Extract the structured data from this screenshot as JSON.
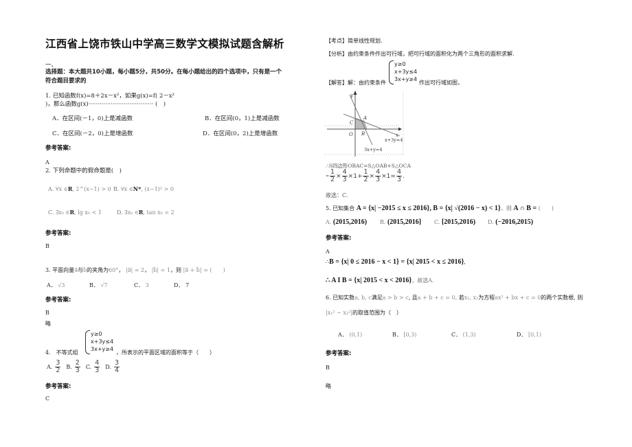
{
  "document": {
    "title": "江西省上饶市铁山中学高三数学文模拟试题含解析",
    "section_number": "一、",
    "section_desc_line1": "选择题：本大题共10小题，每小题5分，共50分。在每小题给出的四个选项中，只有是一个",
    "section_desc_line2": "符合题目要求的",
    "answer_label": "参考答案:"
  },
  "questions": [
    {
      "stem_line1": "1. 已知函数f(x)=8＋2x－x²，如果g(x)=f( 2－x²",
      "stem_line2": ")，那么函数g(x)··································· (　)",
      "options": [
        "A．在区间(－1，0)上是减函数",
        "B．在区间(0，1)上是减函数",
        "C．在区间(－2，0)上是增函数",
        "D．在区间(0，2)上是增函数"
      ],
      "answer": "A"
    },
    {
      "stem": "2. 下列命题中的假命题是(　)",
      "options": [
        {
          "label": "A.",
          "text": "∀x ∈",
          "set": "R",
          "tail": ", 2^(x−1) > 0"
        },
        {
          "label": "B.",
          "text": "∀x ∈",
          "set": "N*",
          "tail": ", (x−1)² > 0"
        },
        {
          "label": "C.",
          "text": "∃x₀ ∈",
          "set": "R",
          "tail": ", lg x₀ < 1"
        },
        {
          "label": "D.",
          "text": "∃x₀ ∈",
          "set": "R",
          "tail": ", tan x₀ = 2"
        }
      ],
      "answer": "B"
    },
    {
      "stem_prefix": "3. 平面向量",
      "vec_a": "a⃗",
      "and": "与",
      "vec_b": "b⃗",
      "angle_text": "的夹角为",
      "angle": "60°",
      "cond1": "|a⃗| = 2",
      "cond2": "|b⃗| = 1",
      "then": "，则",
      "target": "|a⃗ + b⃗| =",
      "paren": "(　　)",
      "options": [
        {
          "label": "A．",
          "value": "√3"
        },
        {
          "label": "B．",
          "value": "√7"
        },
        {
          "label": "C．",
          "value": "3"
        },
        {
          "label": "D．",
          "value": "7"
        }
      ],
      "answer": "B",
      "note": "略"
    },
    {
      "stem_prefix": "4.　不等式组",
      "system": [
        "y≥0",
        "x+3y≤4",
        "3x+y≥4"
      ],
      "stem_suffix": "，所表示的平面区域的面积等于（　　）",
      "options": [
        {
          "label": "A.",
          "num": "3",
          "den": "2"
        },
        {
          "label": "B.",
          "num": "2",
          "den": "3"
        },
        {
          "label": "C.",
          "num": "4",
          "den": "3"
        },
        {
          "label": "D.",
          "num": "3",
          "den": "4"
        }
      ],
      "answer": "C",
      "kaodian": "【考点】简单线性规划.",
      "fenxi": "【分析】由约束条件作出可行域，把可行域的面积化为两个三角形的面积求解.",
      "jieda_prefix": "【解答】解：由约束条件",
      "jieda_suffix": "作出可行域如图，",
      "figure": {
        "axis_x": "x",
        "axis_y": "y",
        "origin": "O",
        "points": [
          "A",
          "B",
          "C"
        ],
        "line1_label": "x+3y=4",
        "line2_label": "3x+y=4"
      },
      "area_line": "∴S四边形OBAC=S△OAB+S△OCA",
      "calc": [
        "1",
        "2",
        "4",
        "3",
        "×1+",
        "1",
        "2",
        "4",
        "3",
        "×1=",
        "4",
        "3"
      ],
      "conclusion": "故选：C."
    },
    {
      "stem_prefix": "5. 已知集合",
      "set_def": "A = {x| −2015 ≤ x ≤ 2016}, B = {x| √(2016 − x) < 1}",
      "stem_then": "，则",
      "target": "A ∩ B =",
      "paren": "(　　)",
      "options": [
        {
          "label": "A.",
          "value": "(2015,2016)"
        },
        {
          "label": "B.",
          "value": "(2015,2016]"
        },
        {
          "label": "C.",
          "value": "[2015,2016)"
        },
        {
          "label": "D.",
          "value": "(−2016,2015)"
        }
      ],
      "answer": "A",
      "sol1_prefix": "∴",
      "sol1": "B = {x| 0 ≤ 2016 − x < 1} = {x| 2015 < x ≤ 2016}",
      "sol2_prefix": "∴ A I  B =",
      "sol2": "{x| 2015 < x < 2016}",
      "sol2_suffix": "，故选A."
    },
    {
      "stem_prefix": "6. 已知实数",
      "vars": "a, b, c",
      "s1": "满足",
      "ineq": "a > b > c",
      "s2": ", 且",
      "eq": "a + b + c = 0",
      "s3": ". 若",
      "roots": "x₁, x₂",
      "s4": "为方程",
      "equation": "ax² + bx + c = 0",
      "s5": "的两个实数根, 则",
      "expr": "|x₁² − x₂²|",
      "s6": "的取值范围为（　）",
      "options": [
        {
          "label": "A．",
          "value": "(0,1)"
        },
        {
          "label": "B．",
          "value": "[0,3)"
        },
        {
          "label": "C．",
          "value": "(1,3)"
        },
        {
          "label": "D．",
          "value": "[0,1)"
        }
      ],
      "answer": "B",
      "note": "略"
    }
  ]
}
